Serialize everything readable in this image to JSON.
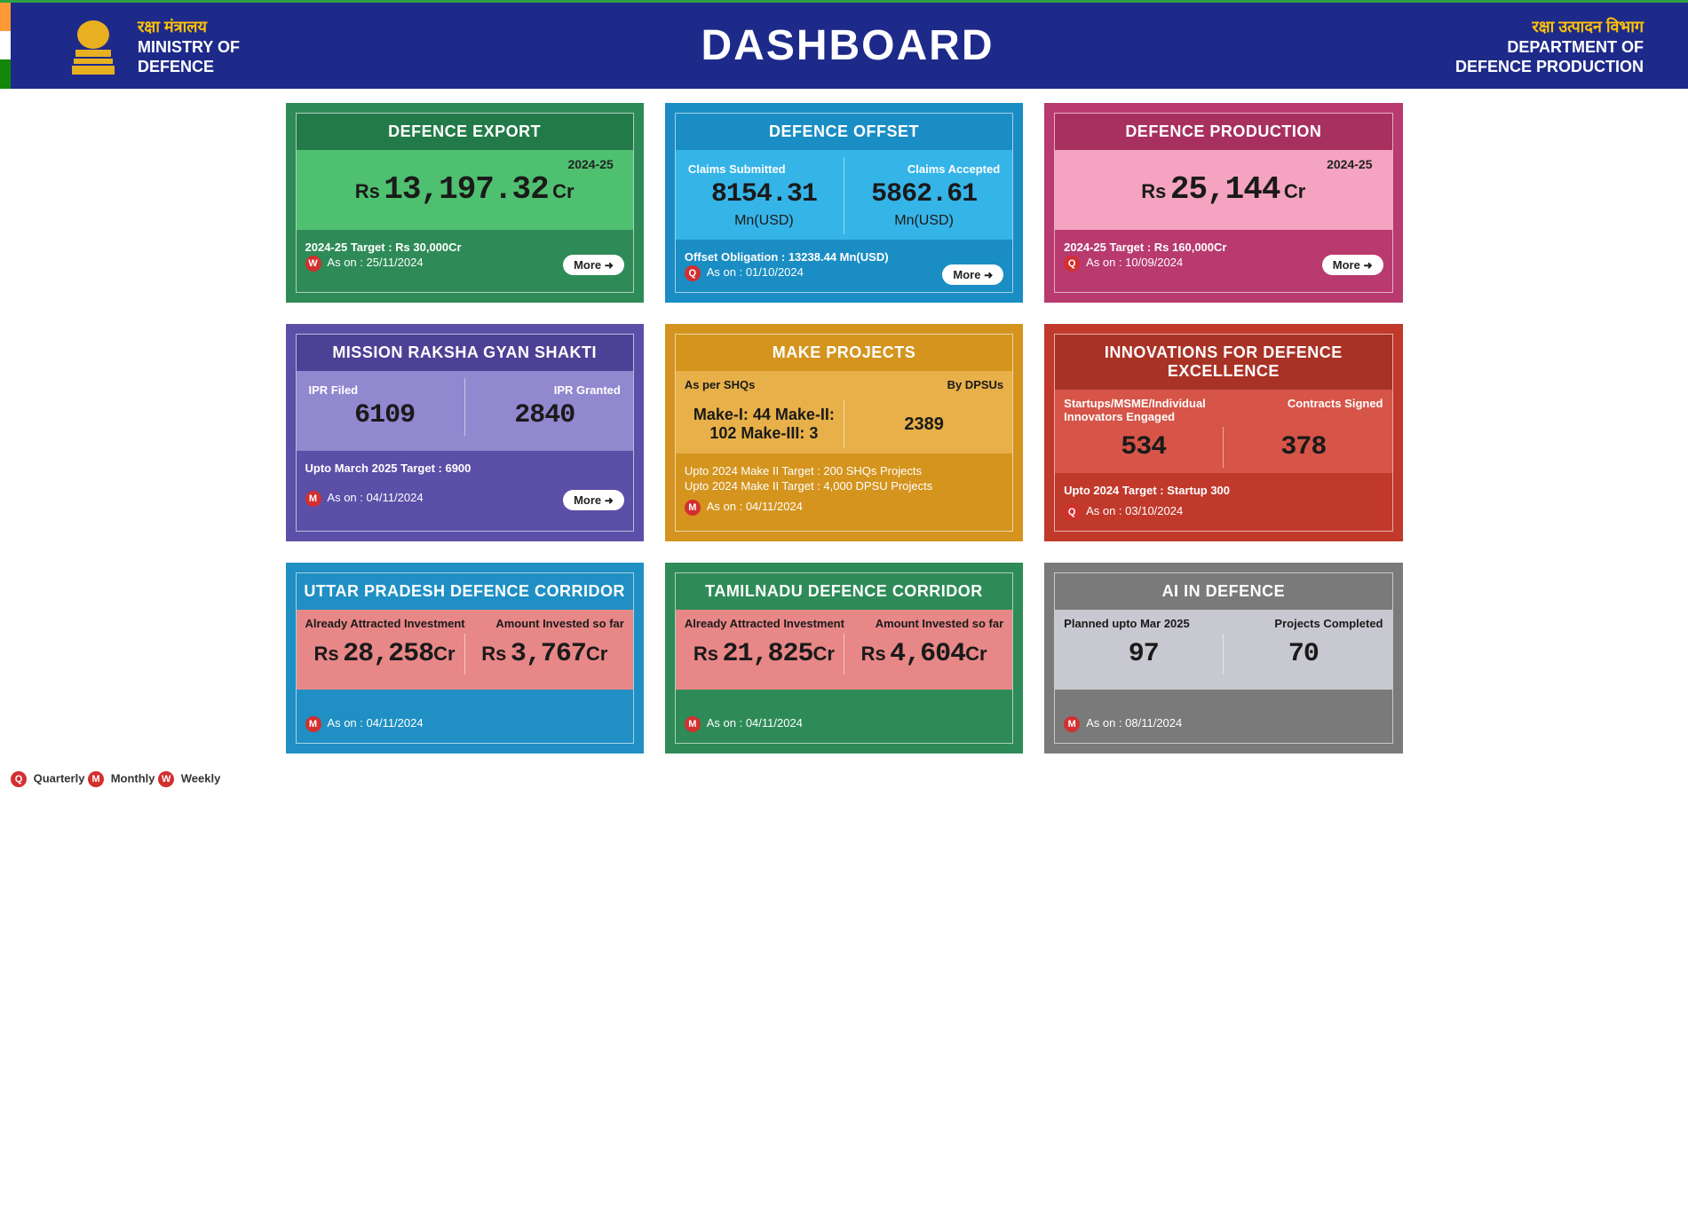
{
  "header": {
    "ministry_hi": "रक्षा मंत्रालय",
    "ministry_en1": "MINISTRY OF",
    "ministry_en2": "DEFENCE",
    "title": "DASHBOARD",
    "dept_hi": "रक्षा उत्पादन विभाग",
    "dept_en1": "DEPARTMENT OF",
    "dept_en2": "DEFENCE PRODUCTION"
  },
  "legend": {
    "q_badge": "Q",
    "q_label": "Quarterly",
    "m_badge": "M",
    "m_label": "Monthly",
    "w_badge": "W",
    "w_label": "Weekly"
  },
  "more_label": "More",
  "cards": {
    "export": {
      "title": "DEFENCE EXPORT",
      "year": "2024-25",
      "pre": "Rs",
      "val": "13,197.32",
      "suf": "Cr",
      "target": "2024-25 Target : Rs 30,000Cr",
      "badge": "W",
      "ason": "As on : 25/11/2024"
    },
    "offset": {
      "title": "DEFENCE OFFSET",
      "l_label": "Claims Submitted",
      "l_val": "8154.31",
      "l_unit": "Mn(USD)",
      "r_label": "Claims Accepted",
      "r_val": "5862.61",
      "r_unit": "Mn(USD)",
      "obl": "Offset Obligation : 13238.44 Mn(USD)",
      "badge": "Q",
      "ason": "As on : 01/10/2024"
    },
    "production": {
      "title": "DEFENCE PRODUCTION",
      "year": "2024-25",
      "pre": "Rs",
      "val": "25,144",
      "suf": "Cr",
      "target": "2024-25 Target : Rs 160,000Cr",
      "badge": "Q",
      "ason": "As on : 10/09/2024"
    },
    "mission": {
      "title": "MISSION RAKSHA GYAN SHAKTI",
      "l_label": "IPR Filed",
      "l_val": "6109",
      "r_label": "IPR Granted",
      "r_val": "2840",
      "target": "Upto March 2025 Target : 6900",
      "badge": "M",
      "ason": "As on : 04/11/2024"
    },
    "make": {
      "title": "MAKE PROJECTS",
      "l_label": "As per SHQs",
      "r_label": "By DPSUs",
      "make_text": "Make-I: 44 Make-II: 102 Make-III: 3",
      "r_val": "2389",
      "t1": "Upto 2024 Make II Target : 200 SHQs Projects",
      "t2": "Upto 2024 Make II Target : 4,000 DPSU Projects",
      "badge": "M",
      "ason": "As on : 04/11/2024"
    },
    "idex": {
      "title": "INNOVATIONS FOR DEFENCE EXCELLENCE",
      "l_label": "Startups/MSME/Individual Innovators Engaged",
      "r_label": "Contracts Signed",
      "l_val": "534",
      "r_val": "378",
      "target": "Upto 2024 Target : Startup 300",
      "badge": "Q",
      "ason": "As on : 03/10/2024"
    },
    "up": {
      "title": "UTTAR PRADESH DEFENCE CORRIDOR",
      "l_label": "Already Attracted Investment",
      "r_label": "Amount Invested so far",
      "l_pre": "Rs",
      "l_val": "28,258",
      "l_suf": "Cr",
      "r_pre": "Rs",
      "r_val": "3,767",
      "r_suf": "Cr",
      "badge": "M",
      "ason": "As on : 04/11/2024"
    },
    "tn": {
      "title": "TAMILNADU DEFENCE CORRIDOR",
      "l_label": "Already Attracted Investment",
      "r_label": "Amount Invested so far",
      "l_pre": "Rs",
      "l_val": "21,825",
      "l_suf": "Cr",
      "r_pre": "Rs",
      "r_val": "4,604",
      "r_suf": "Cr",
      "badge": "M",
      "ason": "As on : 04/11/2024"
    },
    "ai": {
      "title": "AI IN DEFENCE",
      "l_label": "Planned upto Mar 2025",
      "r_label": "Projects Completed",
      "l_val": "97",
      "r_val": "70",
      "badge": "M",
      "ason": "As on : 08/11/2024"
    }
  }
}
